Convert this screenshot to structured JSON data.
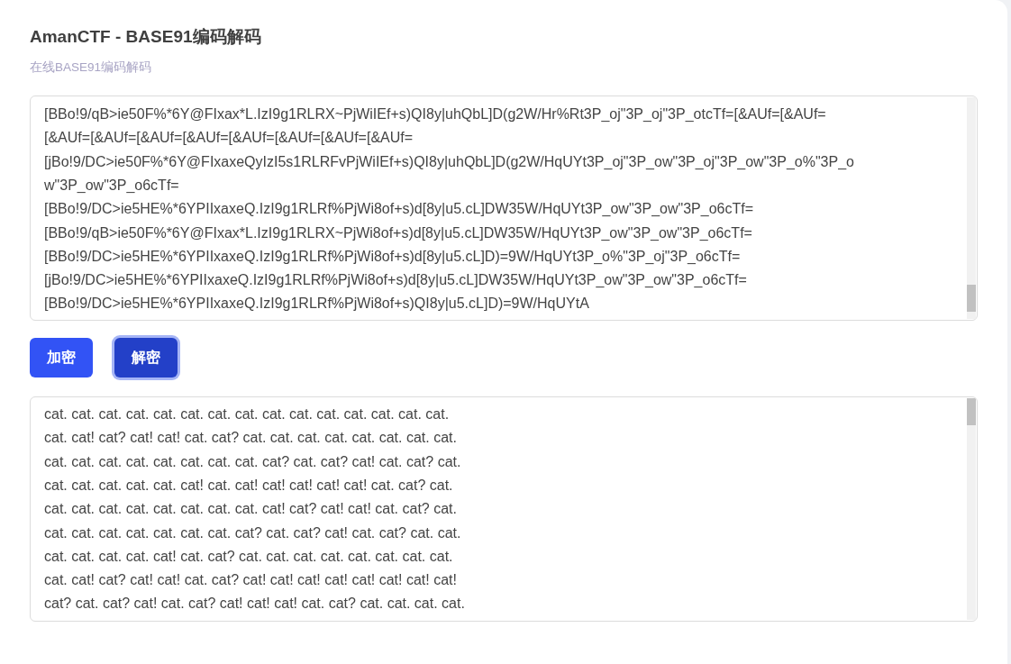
{
  "title": "AmanCTF - BASE91编码解码",
  "subtitle": "在线BASE91编码解码",
  "input": {
    "lines": [
      "[BBo!9/qB>ie50F%*6Y@FIxax*L.IzI9g1RLRX~PjWiIEf+s)QI8y|uhQbL]D(g2W/Hr%Rt3P_oj\"3P_oj\"3P_otcTf=[&AUf=[&AUf=",
      "[&AUf=[&AUf=[&AUf=[&AUf=[&AUf=[&AUf=[&AUf=[&AUf=",
      "[jBo!9/DC>ie50F%*6Y@FIxaxeQyIzI5s1RLRFvPjWiIEf+s)QI8y|uhQbL]D(g2W/HqUYt3P_oj\"3P_ow\"3P_oj\"3P_ow\"3P_o%\"3P_o",
      "w\"3P_ow\"3P_o6cTf=",
      "[BBo!9/DC>ie5HE%*6YPIIxaxeQ.IzI9g1RLRf%PjWi8of+s)d[8y|u5.cL]DW35W/HqUYt3P_ow\"3P_ow\"3P_o6cTf=",
      "[BBo!9/qB>ie50F%*6Y@FIxax*L.IzI9g1RLRX~PjWi8of+s)d[8y|u5.cL]DW35W/HqUYt3P_ow\"3P_ow\"3P_o6cTf=",
      "[BBo!9/DC>ie5HE%*6YPIIxaxeQ.IzI9g1RLRf%PjWi8of+s)d[8y|u5.cL]D)=9W/HqUYt3P_o%\"3P_oj\"3P_o6cTf=",
      "[jBo!9/DC>ie5HE%*6YPIIxaxeQ.IzI9g1RLRf%PjWi8of+s)d[8y|u5.cL]DW35W/HqUYt3P_ow\"3P_ow\"3P_o6cTf=",
      "[BBo!9/DC>ie5HE%*6YPIIxaxeQ.IzI9g1RLRf%PjWi8of+s)QI8y|u5.cL]D)=9W/HqUYtA"
    ]
  },
  "buttons": [
    {
      "label": "加密",
      "focused": false
    },
    {
      "label": "解密",
      "focused": true
    }
  ],
  "output": {
    "lines": [
      "cat. cat. cat. cat. cat. cat. cat. cat. cat. cat. cat. cat. cat. cat. cat.",
      "cat. cat! cat? cat! cat! cat. cat? cat. cat. cat. cat. cat. cat. cat. cat.",
      "cat. cat. cat. cat. cat. cat. cat. cat. cat? cat. cat? cat! cat. cat? cat.",
      "cat. cat. cat. cat. cat. cat! cat. cat! cat! cat! cat! cat! cat. cat? cat.",
      "cat. cat. cat. cat. cat. cat. cat. cat. cat! cat? cat! cat! cat. cat? cat.",
      "cat. cat. cat. cat. cat. cat. cat. cat? cat. cat? cat! cat. cat? cat. cat.",
      "cat. cat. cat. cat. cat! cat. cat? cat. cat. cat. cat. cat. cat. cat. cat.",
      "cat. cat! cat? cat! cat! cat. cat? cat! cat! cat! cat! cat! cat! cat! cat!",
      "cat? cat. cat? cat! cat. cat? cat! cat! cat! cat. cat? cat. cat. cat. cat."
    ]
  }
}
